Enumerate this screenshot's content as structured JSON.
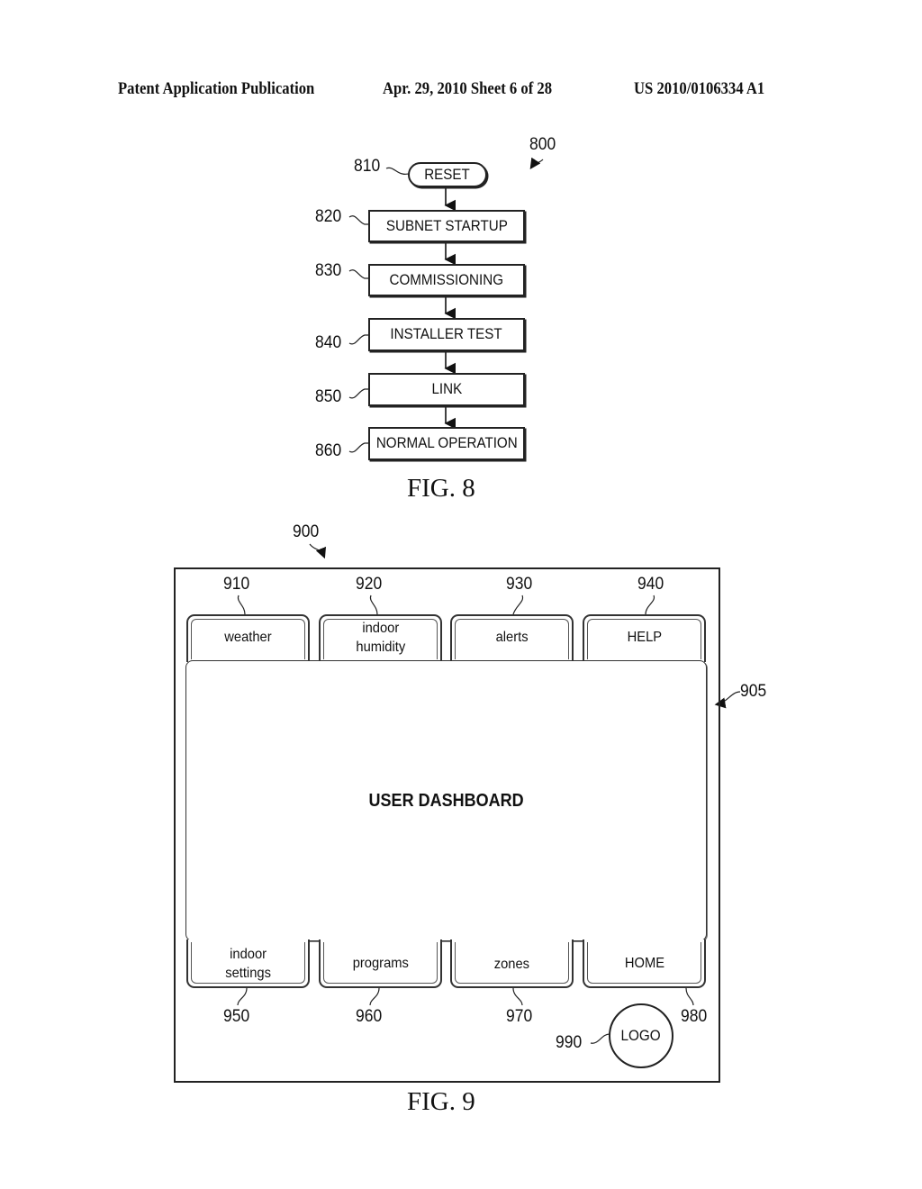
{
  "header": {
    "publication": "Patent Application Publication",
    "date_sheet": "Apr. 29, 2010  Sheet 6 of 28",
    "patent_number": "US 2010/0106334 A1"
  },
  "fig8": {
    "ref": "800",
    "caption": "FIG. 8",
    "steps": [
      {
        "ref": "810",
        "label": "RESET",
        "shape": "terminal"
      },
      {
        "ref": "820",
        "label": "SUBNET STARTUP",
        "shape": "process"
      },
      {
        "ref": "830",
        "label": "COMMISSIONING",
        "shape": "process"
      },
      {
        "ref": "840",
        "label": "INSTALLER TEST",
        "shape": "process"
      },
      {
        "ref": "850",
        "label": "LINK",
        "shape": "process"
      },
      {
        "ref": "860",
        "label": "NORMAL OPERATION",
        "shape": "process"
      }
    ]
  },
  "fig9": {
    "ref": "900",
    "screen_ref": "905",
    "caption": "FIG. 9",
    "dashboard_label": "USER DASHBOARD",
    "top_tabs": [
      {
        "ref": "910",
        "label": "weather"
      },
      {
        "ref": "920",
        "label": "indoor\nhumidity"
      },
      {
        "ref": "930",
        "label": "alerts"
      },
      {
        "ref": "940",
        "label": "HELP"
      }
    ],
    "bottom_tabs": [
      {
        "ref": "950",
        "label": "indoor\nsettings"
      },
      {
        "ref": "960",
        "label": "programs"
      },
      {
        "ref": "970",
        "label": "zones"
      },
      {
        "ref": "980",
        "label": "HOME"
      }
    ],
    "logo": {
      "ref": "990",
      "label": "LOGO"
    }
  }
}
